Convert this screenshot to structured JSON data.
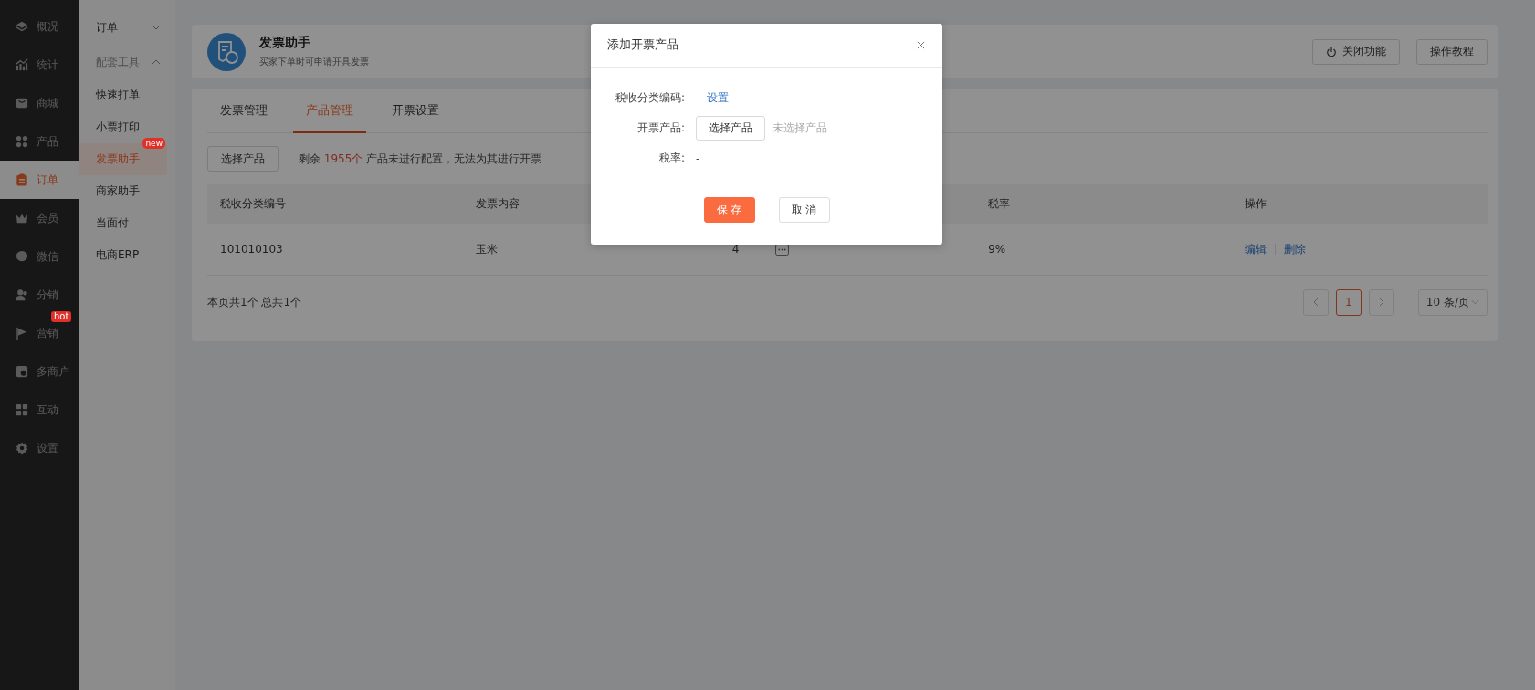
{
  "nav": [
    {
      "label": "概况",
      "selected": false
    },
    {
      "label": "统计",
      "selected": false
    },
    {
      "label": "商城",
      "selected": false
    },
    {
      "label": "产品",
      "selected": false
    },
    {
      "label": "订单",
      "selected": true
    },
    {
      "label": "会员",
      "selected": false
    },
    {
      "label": "微信",
      "selected": false
    },
    {
      "label": "分销",
      "selected": false
    },
    {
      "label": "营销",
      "selected": false,
      "badge": "hot"
    },
    {
      "label": "多商户",
      "selected": false
    },
    {
      "label": "互动",
      "selected": false
    },
    {
      "label": "设置",
      "selected": false
    }
  ],
  "subnav": [
    {
      "label": "订单",
      "expanded": false
    },
    {
      "label": "配套工具",
      "expanded": true,
      "children": [
        {
          "label": "快速打单",
          "selected": false
        },
        {
          "label": "小票打印",
          "selected": false
        },
        {
          "label": "发票助手",
          "selected": true,
          "badge": "new"
        },
        {
          "label": "商家助手",
          "selected": false
        },
        {
          "label": "当面付",
          "selected": false
        },
        {
          "label": "电商ERP",
          "selected": false
        }
      ]
    }
  ],
  "header": {
    "title": "发票助手",
    "subtitle": "买家下单时可申请开具发票",
    "buttons": [
      {
        "label": "关闭功能",
        "kind": "power"
      },
      {
        "label": "操作教程",
        "kind": "plain"
      }
    ]
  },
  "tabs": [
    {
      "label": "发票管理",
      "selected": false
    },
    {
      "label": "产品管理",
      "selected": true
    },
    {
      "label": "开票设置",
      "selected": false
    }
  ],
  "toolbar": {
    "button": "选择产品",
    "notice_prefix": "剩余",
    "notice_count": "1955个",
    "notice_suffix": "产品未进行配置，无法为其进行开票"
  },
  "table": {
    "columns": [
      "税收分类编号",
      "发票内容",
      "税率",
      "操作"
    ],
    "rows": [
      {
        "code": "101010103",
        "content": "玉米",
        "column_3": "4",
        "rate": "9%",
        "actions": [
          "编辑",
          "删除"
        ]
      }
    ]
  },
  "footer": {
    "summary": "本页共1个 总共1个",
    "pages": [
      {
        "label": "1",
        "selected": true
      }
    ],
    "page_size": "10 条/页"
  },
  "modal": {
    "title": "添加开票产品",
    "fields": [
      {
        "kind": "link",
        "label": "税收分类编码:",
        "value": "-",
        "link": "设置"
      },
      {
        "kind": "select",
        "label": "开票产品:",
        "button": "选择产品",
        "hint": "未选择产品"
      },
      {
        "kind": "text",
        "label": "税率:",
        "value": "-"
      }
    ],
    "buttons": [
      {
        "label": "保 存",
        "kind": "primary"
      },
      {
        "label": "取 消",
        "kind": "default"
      }
    ]
  }
}
